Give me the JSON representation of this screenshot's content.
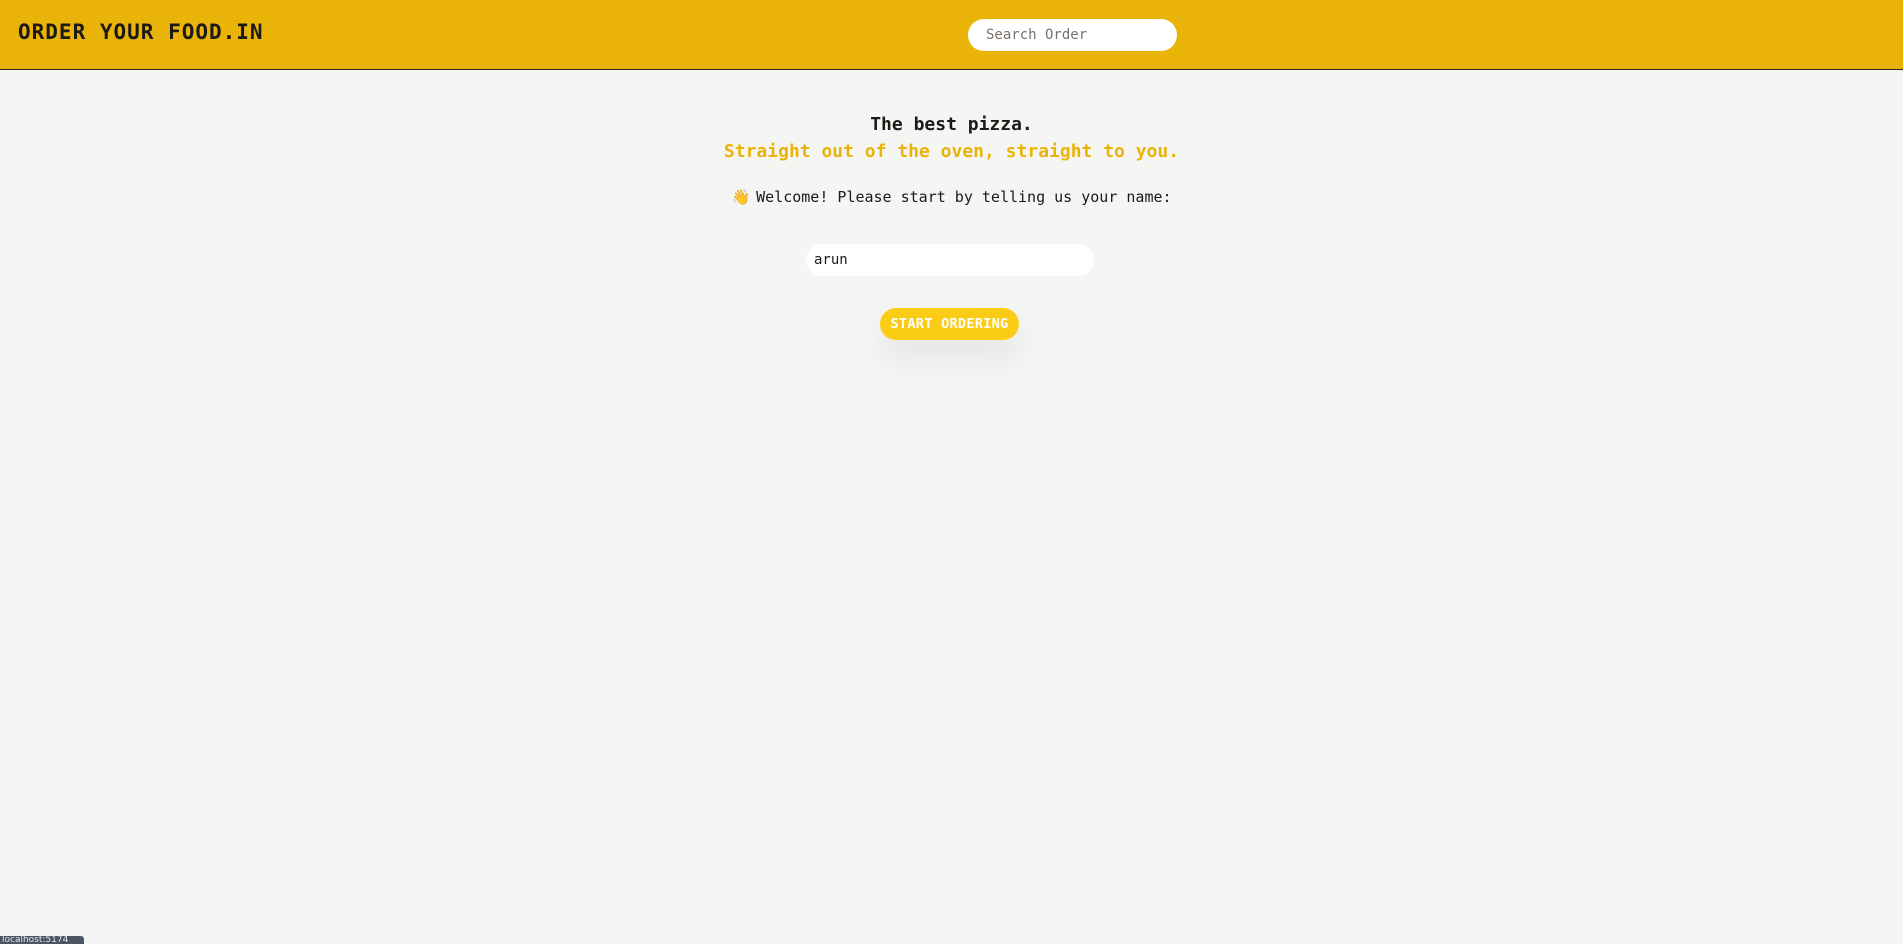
{
  "header": {
    "logo": "ORDER YOUR FOOD.IN",
    "search_placeholder": "Search Order"
  },
  "hero": {
    "title": "The best pizza.",
    "subtitle": "Straight out of the oven, straight to you."
  },
  "form": {
    "welcome_icon": "👋",
    "welcome_text": "Welcome! Please start by telling us your name:",
    "name_value": "arun",
    "button_label": "START ORDERING"
  },
  "status_bar": {
    "url": "localhost:5174"
  },
  "colors": {
    "header_bg": "#eab308",
    "accent": "#eab308",
    "button_bg": "#facc15",
    "page_bg": "#f5f5f4"
  }
}
